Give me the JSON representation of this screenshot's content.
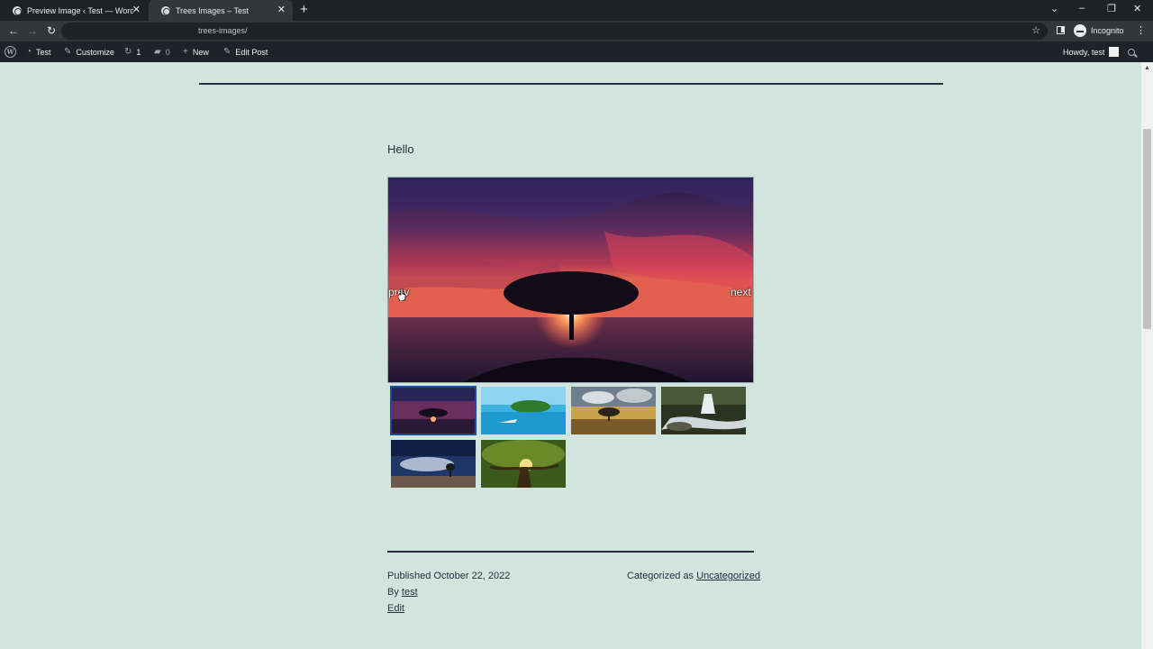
{
  "browser": {
    "tabs": [
      {
        "title": "Preview Image ‹ Test — WordPress",
        "active": false
      },
      {
        "title": "Trees Images – Test",
        "active": true
      }
    ],
    "url": "trees-images/",
    "profile_label": "Incognito"
  },
  "adminbar": {
    "site_name": "Test",
    "customize": "Customize",
    "updates_count": "1",
    "comments_count": "0",
    "new_label": "New",
    "edit_post": "Edit Post",
    "howdy": "Howdy, test"
  },
  "post": {
    "intro": "Hello",
    "gallery": {
      "prev_label": "prev",
      "next_label": "next",
      "current_index": 0,
      "thumbnails": [
        {
          "subject": "lone tree at red sunset over sea",
          "selected": true
        },
        {
          "subject": "tropical island with boat"
        },
        {
          "subject": "tree in field at golden hour"
        },
        {
          "subject": "forest waterfall over rocks"
        },
        {
          "subject": "small tree on rocks under blue sky"
        },
        {
          "subject": "large green tree with sunlight"
        }
      ]
    }
  },
  "meta": {
    "published_prefix": "Published",
    "published_date": "October 22, 2022",
    "categorized_prefix": "Categorized as",
    "category": "Uncategorized",
    "by_prefix": "By",
    "author": "test",
    "edit": "Edit"
  }
}
